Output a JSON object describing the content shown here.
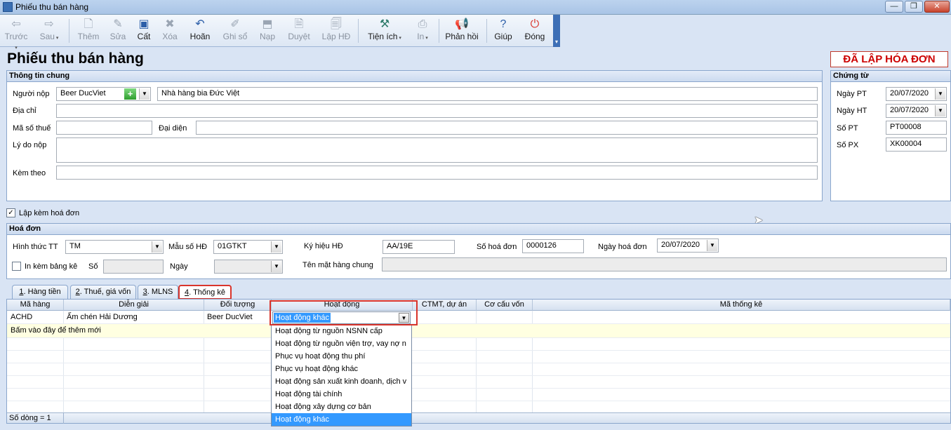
{
  "window": {
    "title": "Phiếu thu bán hàng"
  },
  "toolbar": {
    "back": "Trước",
    "next": "Sau",
    "add": "Thêm",
    "edit": "Sửa",
    "save": "Cất",
    "delete": "Xóa",
    "undo": "Hoãn",
    "post": "Ghi sổ",
    "load": "Nạp",
    "approve": "Duyệt",
    "create_invoice": "Lập HĐ",
    "utilities": "Tiện ích",
    "print": "In",
    "feedback": "Phản hồi",
    "help": "Giúp",
    "close": "Đóng"
  },
  "page_title": "Phiếu thu bán hàng",
  "status_banner": "ĐÃ LẬP HÓA ĐƠN",
  "general": {
    "header": "Thông tin chung",
    "payer_label": "Người nộp",
    "payer_code": "Beer DucViet",
    "payer_name": "Nhà hàng bia Đức Việt",
    "address_label": "Địa chỉ",
    "address": "",
    "tax_label": "Mã số thuế",
    "tax": "",
    "rep_label": "Đại diện",
    "rep": "",
    "reason_label": "Lý do nộp",
    "reason": "",
    "attach_label": "Kèm theo",
    "attach": ""
  },
  "voucher": {
    "header": "Chứng từ",
    "date_pt_label": "Ngày PT",
    "date_pt": "20/07/2020",
    "date_ht_label": "Ngày HT",
    "date_ht": "20/07/2020",
    "no_pt_label": "Số PT",
    "no_pt": "PT00008",
    "no_px_label": "Số PX",
    "no_px": "XK00004"
  },
  "with_invoice_label": "Lập kèm hoá đơn",
  "with_invoice_checked": true,
  "invoice": {
    "header": "Hoá đơn",
    "pay_method_label": "Hình thức TT",
    "pay_method": "TM",
    "template_label": "Mẫu số HĐ",
    "template": "01GTKT",
    "symbol_label": "Ký hiệu HĐ",
    "symbol": "AA/19E",
    "number_label": "Số hoá đơn",
    "number": "0000126",
    "date_label": "Ngày hoá đơn",
    "date": "20/07/2020",
    "print_list_label": "In kèm bảng kê",
    "list_no_label": "Số",
    "list_no": "",
    "list_date_label": "Ngày",
    "list_date": "",
    "goods_name_label": "Tên mặt hàng chung",
    "goods_name": ""
  },
  "tabs": [
    {
      "key": "1",
      "rest": ". Hàng tiền"
    },
    {
      "key": "2",
      "rest": ". Thuế, giá vốn"
    },
    {
      "key": "3",
      "rest": ". MLNS"
    },
    {
      "key": "4",
      "rest": ". Thống kê"
    }
  ],
  "grid": {
    "columns": [
      "Mã hàng",
      "Diễn giải",
      "Đối tượng",
      "Hoạt động",
      "CTMT, dự án",
      "Cơ cấu vốn",
      "Mã thống kê"
    ],
    "rows": [
      {
        "code": "ACHD",
        "desc": "Ấm chén Hải Dương",
        "object": "Beer DucViet",
        "activity": "Hoạt động khác"
      }
    ],
    "add_new": "Bấm vào đây để thêm mới",
    "row_count": "Số dòng = 1"
  },
  "activity_options": [
    "Hoạt động từ nguồn NSNN cấp",
    "Hoạt động từ nguồn viện trợ, vay nợ n",
    "Phục vụ hoạt động thu phí",
    "Phục vụ hoạt động khác",
    "Hoạt động sản xuất kinh doanh, dịch v",
    "Hoạt động tài chính",
    "Hoạt động xây dựng cơ bản",
    "Hoạt động khác"
  ],
  "colors": {
    "accent": "#3399ff",
    "highlight": "#d9342b",
    "banner": "#cc0000"
  }
}
